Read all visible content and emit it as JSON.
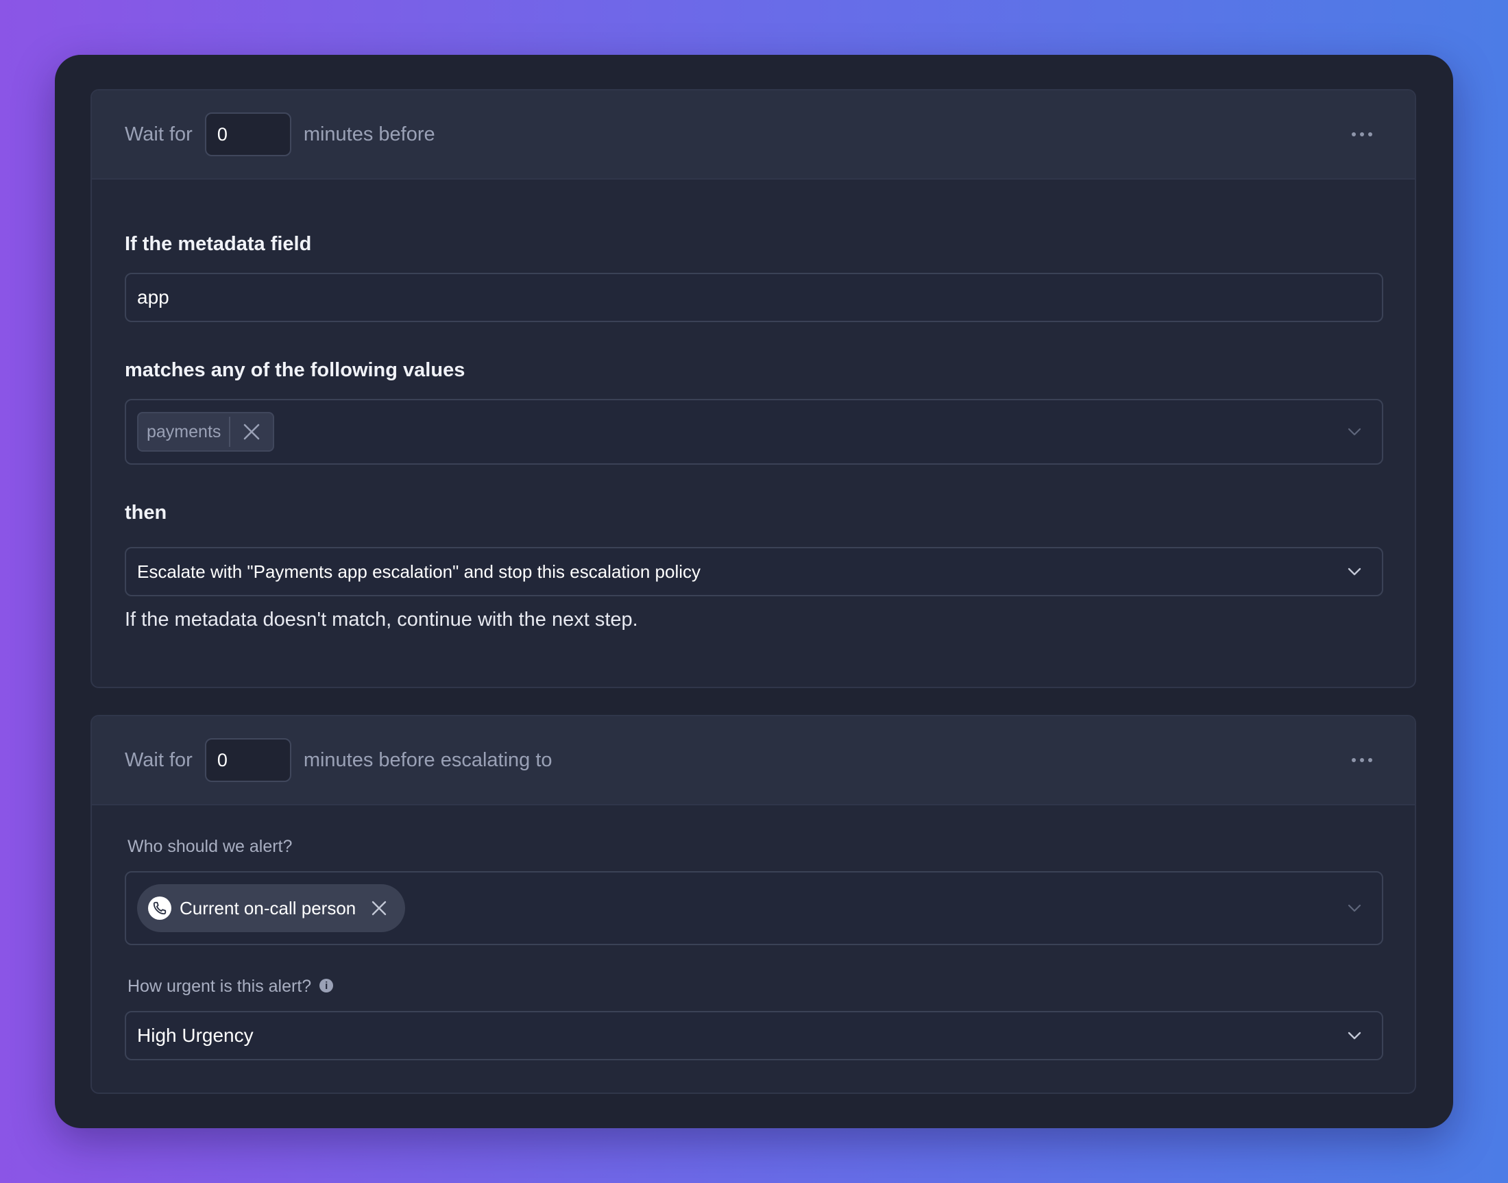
{
  "step1": {
    "wait_prefix": "Wait for",
    "wait_value": "0",
    "wait_suffix": "minutes before",
    "metadata_label": "If the metadata field",
    "metadata_value": "app",
    "matches_label": "matches any of the following values",
    "match_chips": [
      "payments"
    ],
    "then_label": "then",
    "then_value": "Escalate with \"Payments app escalation\" and stop this escalation policy",
    "note": "If the metadata doesn't match, continue with the next step."
  },
  "step2": {
    "wait_prefix": "Wait for",
    "wait_value": "0",
    "wait_suffix": "minutes before escalating to",
    "who_label": "Who should we alert?",
    "who_chip": "Current on-call person",
    "urgency_label": "How urgent is this alert?",
    "urgency_value": "High Urgency"
  },
  "icons": {
    "more": "more-horizontal-icon",
    "chevron": "chevron-down-icon",
    "remove": "close-icon",
    "phone": "phone-icon",
    "info": "info-icon"
  },
  "colors": {
    "background_start": "#8b55e6",
    "background_end": "#4c7ce6",
    "window": "#1f2332",
    "card": "#232839"
  }
}
